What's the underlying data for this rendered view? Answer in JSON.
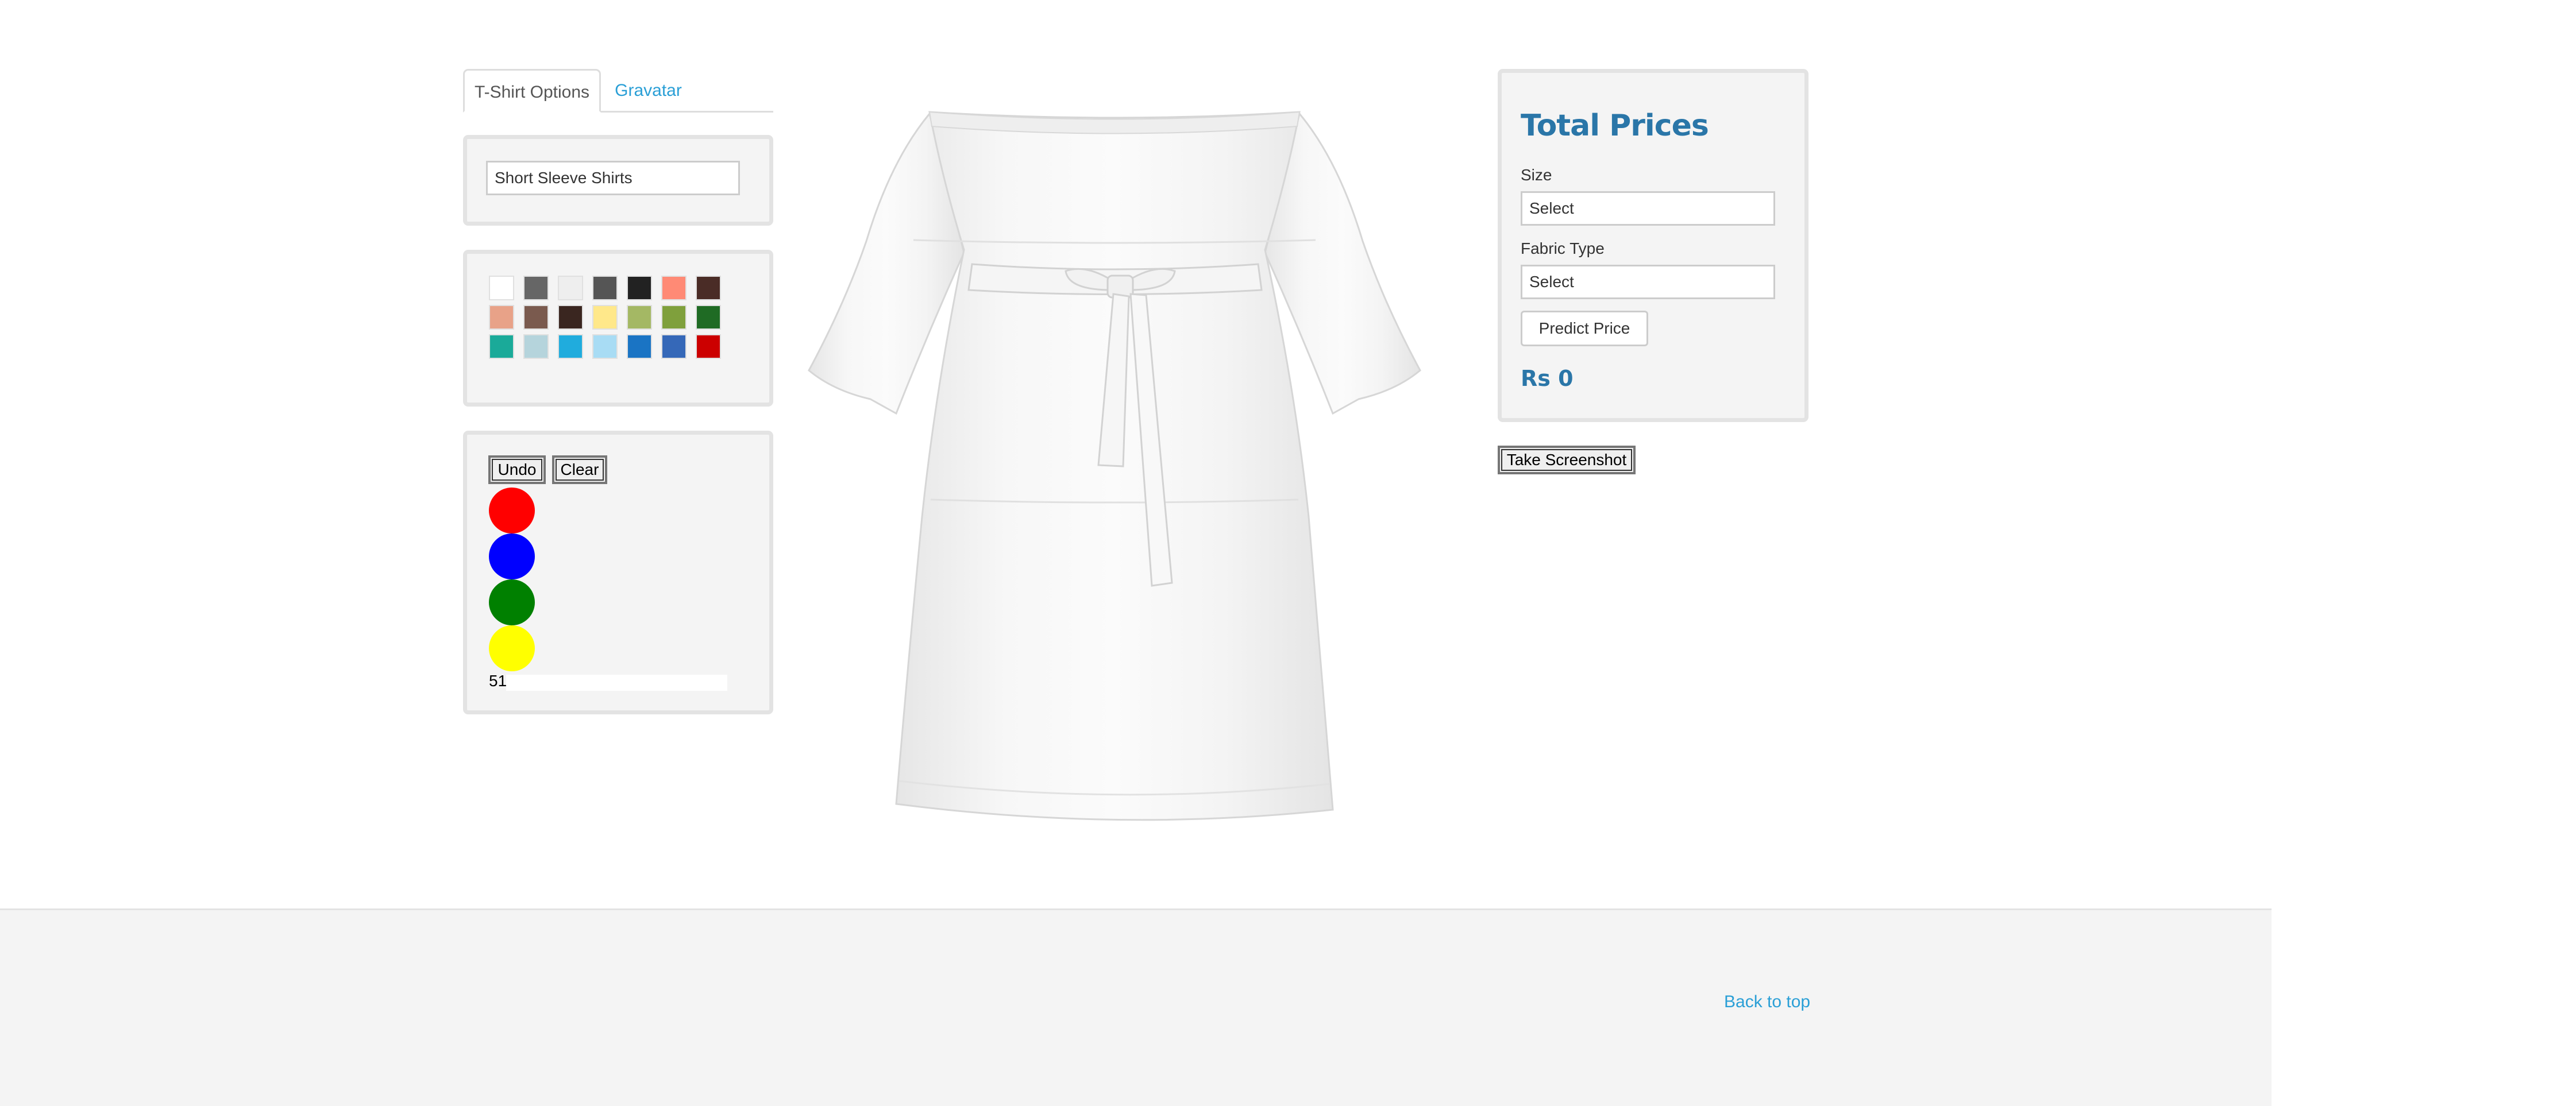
{
  "tabs": [
    {
      "label": "T-Shirt Options",
      "active": true
    },
    {
      "label": "Gravatar",
      "active": false
    }
  ],
  "shirt_type": {
    "value": "Short Sleeve Shirts"
  },
  "color_palette": {
    "rows": [
      [
        "#ffffff",
        "#666666",
        "#eeeeee",
        "#555555",
        "#222222",
        "#ff8a75",
        "#4a2c26"
      ],
      [
        "#e8a288",
        "#7a5a4e",
        "#3a2620",
        "#ffe88a",
        "#a4b864",
        "#7fa03c",
        "#1f6b24"
      ],
      [
        "#1aaa99",
        "#b5d4dc",
        "#20acdd",
        "#a8dcf4",
        "#1a74c4",
        "#3568b8",
        "#cc0000"
      ]
    ]
  },
  "drawing_tools": {
    "undo_label": "Undo",
    "clear_label": "Clear",
    "brush_colors": [
      "#ff0000",
      "#0000ff",
      "#008000",
      "#ffff00"
    ],
    "brush_size": "51"
  },
  "product_image": {
    "name": "white-off-shoulder-dress",
    "background": "#ffffff",
    "fabric_color": "#f4f4f4"
  },
  "prices": {
    "title": "Total Prices",
    "size_label": "Size",
    "size_value": "Select",
    "fabric_label": "Fabric Type",
    "fabric_value": "Select",
    "predict_label": "Predict Price",
    "result": "Rs 0"
  },
  "screenshot_label": "Take Screenshot",
  "footer": {
    "back_to_top": "Back to top"
  }
}
